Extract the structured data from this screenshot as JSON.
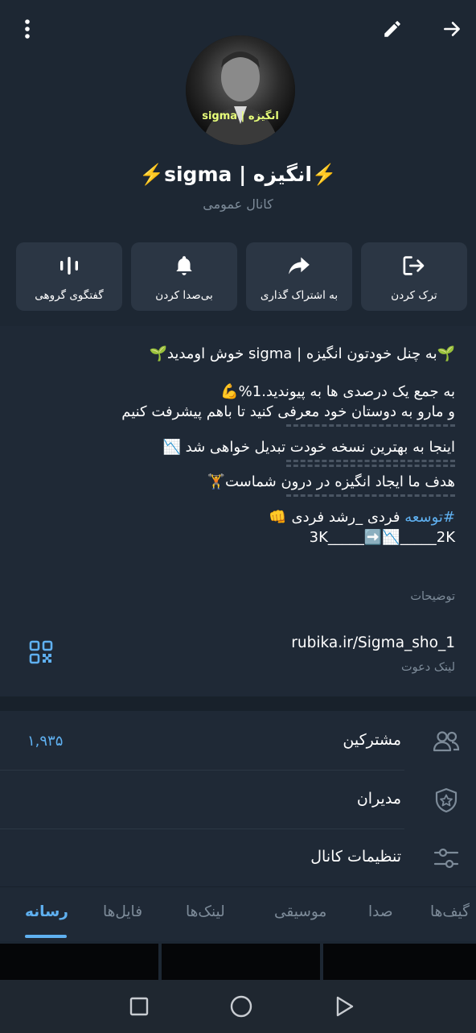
{
  "header": {
    "title": "⚡️انگیزه | sigma⚡️",
    "subtitle": "کانال عمومی",
    "avatar_text": "sigma | انگیزه"
  },
  "actions": [
    {
      "label": "گفتگوی گروهی",
      "icon": "voice-chat-icon"
    },
    {
      "label": "بی‌صدا کردن",
      "icon": "bell-icon"
    },
    {
      "label": "به اشتراک گذاری",
      "icon": "share-icon"
    },
    {
      "label": "ترک کردن",
      "icon": "leave-icon"
    }
  ],
  "description": {
    "line1": "🌱به چنل خودتون انگیزه | sigma خوش اومدید🌱",
    "line2": "به جمع یک درصدی ها به پیوندید.1%💪",
    "line3": "و مارو به دوستان خود معرفی کنید تا باهم پیشرفت کنیم",
    "line4": "اینجا به بهترین نسخه خودت تبدیل خواهی شد 📉",
    "line5": "هدف ما ایجاد انگیزه در درون شماست🏋",
    "hashtag": "#توسعه",
    "line6_rest": " فردی _رشد فردی 👊",
    "line7": "3K_____➡️📉_____2K",
    "caption": "توضیحات"
  },
  "invite": {
    "link": "rubika.ir/Sigma_sho_1",
    "caption": "لینک دعوت"
  },
  "rows": [
    {
      "label": "مشترکین",
      "value": "۱,۹۳۵",
      "icon": "people-icon"
    },
    {
      "label": "مدیران",
      "value": "",
      "icon": "admin-shield-icon"
    },
    {
      "label": "تنظیمات کانال",
      "value": "",
      "icon": "settings-sliders-icon"
    }
  ],
  "tabs": [
    "رسانه",
    "فایل‌ها",
    "لینک‌ها",
    "موسیقی",
    "صدا",
    "گیف‌ها"
  ],
  "active_tab": "رسانه",
  "colors": {
    "background": "#1d2733",
    "card": "#2b3644",
    "accent": "#5fb0f0",
    "muted": "#7d8b99"
  }
}
